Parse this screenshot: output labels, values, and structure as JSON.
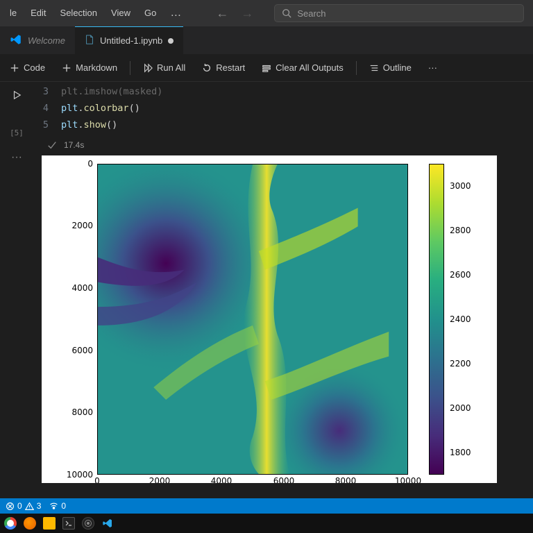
{
  "menu": {
    "items": [
      "le",
      "Edit",
      "Selection",
      "View",
      "Go"
    ],
    "more": "…"
  },
  "search": {
    "placeholder": "Search"
  },
  "tabs": [
    {
      "label": "Welcome",
      "kind": "vscode",
      "active": false,
      "italic": true
    },
    {
      "label": "Untitled-1.ipynb",
      "kind": "jupyter",
      "active": true,
      "dirty": true
    }
  ],
  "notebook_toolbar": {
    "code": "Code",
    "markdown": "Markdown",
    "run_all": "Run All",
    "restart": "Restart",
    "clear_outputs": "Clear All Outputs",
    "outline": "Outline",
    "more": "···"
  },
  "cell": {
    "exec_count": "[5]",
    "lines": [
      {
        "n": "3",
        "segments": [
          {
            "t": "plt",
            "c": "c-dim"
          },
          {
            "t": ".",
            "c": "c-dim"
          },
          {
            "t": "imshow",
            "c": "c-dim"
          },
          {
            "t": "(",
            "c": "c-dim"
          },
          {
            "t": "masked",
            "c": "c-dim"
          },
          {
            "t": ")",
            "c": "c-dim"
          }
        ]
      },
      {
        "n": "4",
        "segments": [
          {
            "t": "plt",
            "c": "c-var"
          },
          {
            "t": ".",
            "c": "c-pun"
          },
          {
            "t": "colorbar",
            "c": "c-fn"
          },
          {
            "t": "()",
            "c": "c-pun"
          }
        ]
      },
      {
        "n": "5",
        "segments": [
          {
            "t": "plt",
            "c": "c-var"
          },
          {
            "t": ".",
            "c": "c-pun"
          },
          {
            "t": "show",
            "c": "c-fn"
          },
          {
            "t": "()",
            "c": "c-pun"
          }
        ]
      }
    ],
    "status_time": "17.4s"
  },
  "chart_data": {
    "type": "heatmap",
    "title": "",
    "xlabel": "",
    "ylabel": "",
    "xlim": [
      0,
      10000
    ],
    "ylim": [
      0,
      10000
    ],
    "y_inverted": true,
    "xticks": [
      0,
      2000,
      4000,
      6000,
      8000,
      10000
    ],
    "yticks": [
      0,
      2000,
      4000,
      6000,
      8000,
      10000
    ],
    "colormap": "viridis",
    "value_range_approx": [
      1700,
      3100
    ],
    "colorbar_ticks": [
      1800,
      2000,
      2200,
      2400,
      2600,
      2800,
      3000
    ],
    "description": "Elevation-like raster (~10000×10000 pixel index space) rendered with matplotlib imshow + colorbar. Low values (deep purple) cluster in a dendritic valley network in the upper-left and a pocket lower-right; a bright yellow ridge (~3000) runs roughly vertically just right of center with branching tributary ridges; broad mid-range teal/green (~2200–2600) fills the remainder."
  },
  "statusbar": {
    "errors": "0",
    "warnings": "3",
    "ports": "0"
  },
  "taskbar_apps": [
    "chrome",
    "firefox",
    "files",
    "terminal",
    "obs",
    "vscode"
  ]
}
